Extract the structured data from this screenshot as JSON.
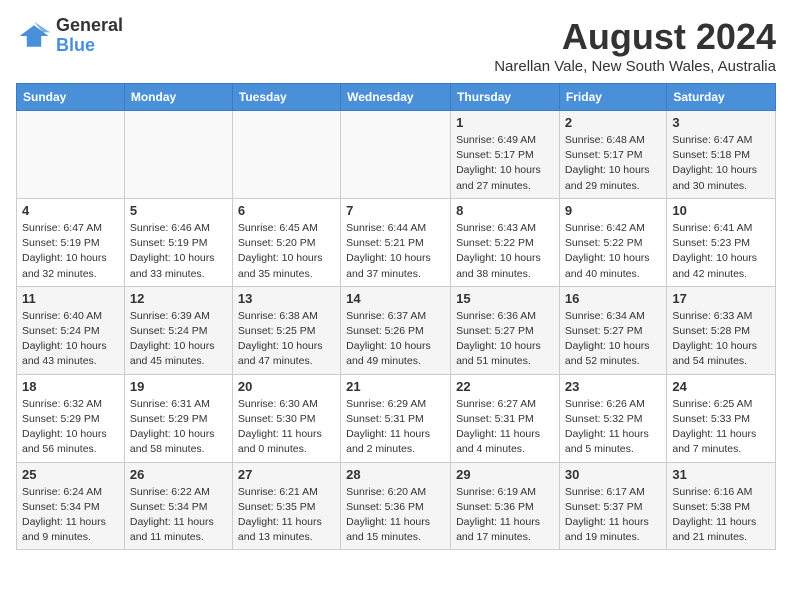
{
  "header": {
    "logo_line1": "General",
    "logo_line2": "Blue",
    "title": "August 2024",
    "subtitle": "Narellan Vale, New South Wales, Australia"
  },
  "days_of_week": [
    "Sunday",
    "Monday",
    "Tuesday",
    "Wednesday",
    "Thursday",
    "Friday",
    "Saturday"
  ],
  "weeks": [
    [
      {
        "day": "",
        "info": ""
      },
      {
        "day": "",
        "info": ""
      },
      {
        "day": "",
        "info": ""
      },
      {
        "day": "",
        "info": ""
      },
      {
        "day": "1",
        "info": "Sunrise: 6:49 AM\nSunset: 5:17 PM\nDaylight: 10 hours\nand 27 minutes."
      },
      {
        "day": "2",
        "info": "Sunrise: 6:48 AM\nSunset: 5:17 PM\nDaylight: 10 hours\nand 29 minutes."
      },
      {
        "day": "3",
        "info": "Sunrise: 6:47 AM\nSunset: 5:18 PM\nDaylight: 10 hours\nand 30 minutes."
      }
    ],
    [
      {
        "day": "4",
        "info": "Sunrise: 6:47 AM\nSunset: 5:19 PM\nDaylight: 10 hours\nand 32 minutes."
      },
      {
        "day": "5",
        "info": "Sunrise: 6:46 AM\nSunset: 5:19 PM\nDaylight: 10 hours\nand 33 minutes."
      },
      {
        "day": "6",
        "info": "Sunrise: 6:45 AM\nSunset: 5:20 PM\nDaylight: 10 hours\nand 35 minutes."
      },
      {
        "day": "7",
        "info": "Sunrise: 6:44 AM\nSunset: 5:21 PM\nDaylight: 10 hours\nand 37 minutes."
      },
      {
        "day": "8",
        "info": "Sunrise: 6:43 AM\nSunset: 5:22 PM\nDaylight: 10 hours\nand 38 minutes."
      },
      {
        "day": "9",
        "info": "Sunrise: 6:42 AM\nSunset: 5:22 PM\nDaylight: 10 hours\nand 40 minutes."
      },
      {
        "day": "10",
        "info": "Sunrise: 6:41 AM\nSunset: 5:23 PM\nDaylight: 10 hours\nand 42 minutes."
      }
    ],
    [
      {
        "day": "11",
        "info": "Sunrise: 6:40 AM\nSunset: 5:24 PM\nDaylight: 10 hours\nand 43 minutes."
      },
      {
        "day": "12",
        "info": "Sunrise: 6:39 AM\nSunset: 5:24 PM\nDaylight: 10 hours\nand 45 minutes."
      },
      {
        "day": "13",
        "info": "Sunrise: 6:38 AM\nSunset: 5:25 PM\nDaylight: 10 hours\nand 47 minutes."
      },
      {
        "day": "14",
        "info": "Sunrise: 6:37 AM\nSunset: 5:26 PM\nDaylight: 10 hours\nand 49 minutes."
      },
      {
        "day": "15",
        "info": "Sunrise: 6:36 AM\nSunset: 5:27 PM\nDaylight: 10 hours\nand 51 minutes."
      },
      {
        "day": "16",
        "info": "Sunrise: 6:34 AM\nSunset: 5:27 PM\nDaylight: 10 hours\nand 52 minutes."
      },
      {
        "day": "17",
        "info": "Sunrise: 6:33 AM\nSunset: 5:28 PM\nDaylight: 10 hours\nand 54 minutes."
      }
    ],
    [
      {
        "day": "18",
        "info": "Sunrise: 6:32 AM\nSunset: 5:29 PM\nDaylight: 10 hours\nand 56 minutes."
      },
      {
        "day": "19",
        "info": "Sunrise: 6:31 AM\nSunset: 5:29 PM\nDaylight: 10 hours\nand 58 minutes."
      },
      {
        "day": "20",
        "info": "Sunrise: 6:30 AM\nSunset: 5:30 PM\nDaylight: 11 hours\nand 0 minutes."
      },
      {
        "day": "21",
        "info": "Sunrise: 6:29 AM\nSunset: 5:31 PM\nDaylight: 11 hours\nand 2 minutes."
      },
      {
        "day": "22",
        "info": "Sunrise: 6:27 AM\nSunset: 5:31 PM\nDaylight: 11 hours\nand 4 minutes."
      },
      {
        "day": "23",
        "info": "Sunrise: 6:26 AM\nSunset: 5:32 PM\nDaylight: 11 hours\nand 5 minutes."
      },
      {
        "day": "24",
        "info": "Sunrise: 6:25 AM\nSunset: 5:33 PM\nDaylight: 11 hours\nand 7 minutes."
      }
    ],
    [
      {
        "day": "25",
        "info": "Sunrise: 6:24 AM\nSunset: 5:34 PM\nDaylight: 11 hours\nand 9 minutes."
      },
      {
        "day": "26",
        "info": "Sunrise: 6:22 AM\nSunset: 5:34 PM\nDaylight: 11 hours\nand 11 minutes."
      },
      {
        "day": "27",
        "info": "Sunrise: 6:21 AM\nSunset: 5:35 PM\nDaylight: 11 hours\nand 13 minutes."
      },
      {
        "day": "28",
        "info": "Sunrise: 6:20 AM\nSunset: 5:36 PM\nDaylight: 11 hours\nand 15 minutes."
      },
      {
        "day": "29",
        "info": "Sunrise: 6:19 AM\nSunset: 5:36 PM\nDaylight: 11 hours\nand 17 minutes."
      },
      {
        "day": "30",
        "info": "Sunrise: 6:17 AM\nSunset: 5:37 PM\nDaylight: 11 hours\nand 19 minutes."
      },
      {
        "day": "31",
        "info": "Sunrise: 6:16 AM\nSunset: 5:38 PM\nDaylight: 11 hours\nand 21 minutes."
      }
    ]
  ]
}
